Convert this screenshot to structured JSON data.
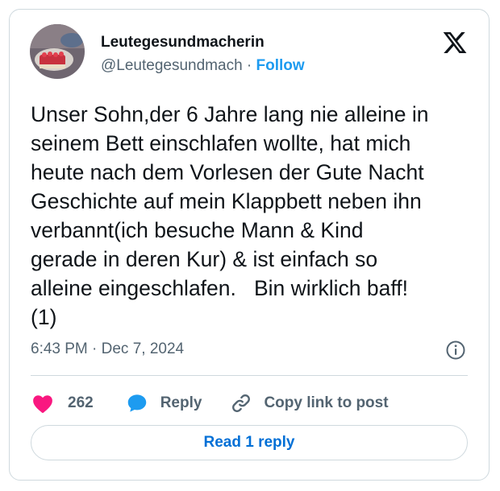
{
  "author": {
    "display_name": "Leutegesundmacherin",
    "handle": "@Leutegesundmach",
    "separator": "·",
    "follow_label": "Follow"
  },
  "tweet": {
    "text": "Unser Sohn,der 6 Jahre lang nie alleine in\nseinem Bett einschlafen wollte, hat mich\nheute nach dem Vorlesen der Gute Nacht\nGeschichte auf mein Klappbett neben ihn\nverbannt(ich besuche Mann & Kind\ngerade in deren Kur) & ist einfach so\nalleine eingeschlafen.   Bin wirklich baff!\n(1)",
    "timestamp": "6:43 PM · Dec 7, 2024"
  },
  "actions": {
    "like_count": "262",
    "reply_label": "Reply",
    "copy_link_label": "Copy link to post"
  },
  "footer": {
    "read_replies_label": "Read 1 reply"
  },
  "colors": {
    "accent": "#1d9bf0",
    "like": "#f91880",
    "read_link": "#006fd6",
    "muted": "#536471"
  },
  "icons": [
    "x-logo-icon",
    "info-icon",
    "heart-icon",
    "reply-bubble-icon",
    "link-icon"
  ]
}
